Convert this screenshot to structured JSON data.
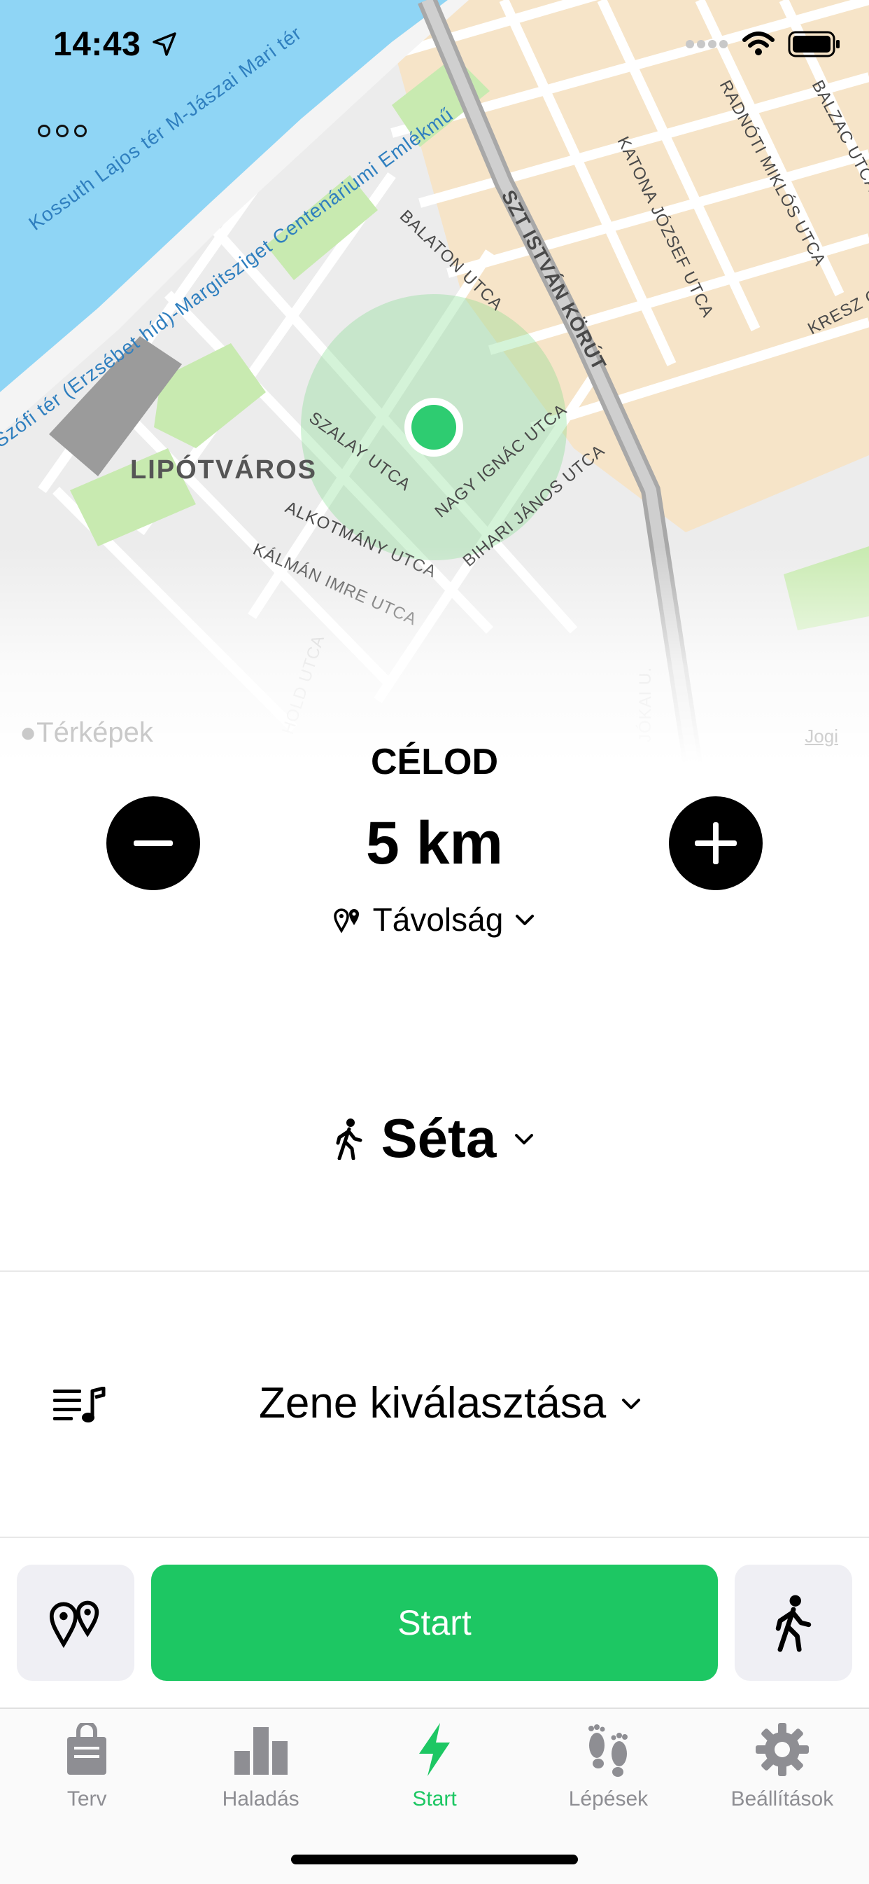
{
  "status_bar": {
    "time": "14:43",
    "icons": [
      "location-arrow-icon",
      "signal-icon",
      "wifi-icon",
      "battery-icon"
    ]
  },
  "map": {
    "district_label": "LIPÓTVÁROS",
    "streets": [
      "Kossuth Lajos tér M-Jászai Mari tér",
      "Szófi tér (Erzsébet híd)-Margitsziget Centenáriumi Emlékmű",
      "BALATON UTCA",
      "SZT ISTVÁN KÖRÚT",
      "KATONA JÓZSEF UTCA",
      "RADNÓTI MIKLÓS UTCA",
      "BALZAC UTCA",
      "KRESZ G.",
      "SZALAY UTCA",
      "NAGY IGNÁC UTCA",
      "BIHARI JÁNOS UTCA",
      "ALKOTMÁNY UTCA",
      "KÁLMÁN IMRE UTCA",
      "HOLD UTCA",
      "JÓKAI U."
    ],
    "attribution": "Térképek",
    "legal": "Jogi",
    "colors": {
      "water": "#8fd5f5",
      "park": "#c8eab0",
      "block": "#ffe7bf",
      "location": "#2ecc71"
    }
  },
  "goal": {
    "title": "CÉLOD",
    "value": "5 km",
    "type_label": "Távolság",
    "icons": [
      "minus-icon",
      "plus-icon",
      "route-pins-icon",
      "chevron-down-icon"
    ]
  },
  "activity": {
    "label": "Séta",
    "icon": "walking-person-icon"
  },
  "music": {
    "label": "Zene kiválasztása",
    "icon": "playlist-icon"
  },
  "actions": {
    "start_label": "Start",
    "accent_color": "#1dc763"
  },
  "tabs": [
    {
      "label": "Terv",
      "icon": "bag-icon",
      "active": false
    },
    {
      "label": "Haladás",
      "icon": "bar-chart-icon",
      "active": false
    },
    {
      "label": "Start",
      "icon": "bolt-icon",
      "active": true
    },
    {
      "label": "Lépések",
      "icon": "footprints-icon",
      "active": false
    },
    {
      "label": "Beállítások",
      "icon": "gear-icon",
      "active": false
    }
  ]
}
